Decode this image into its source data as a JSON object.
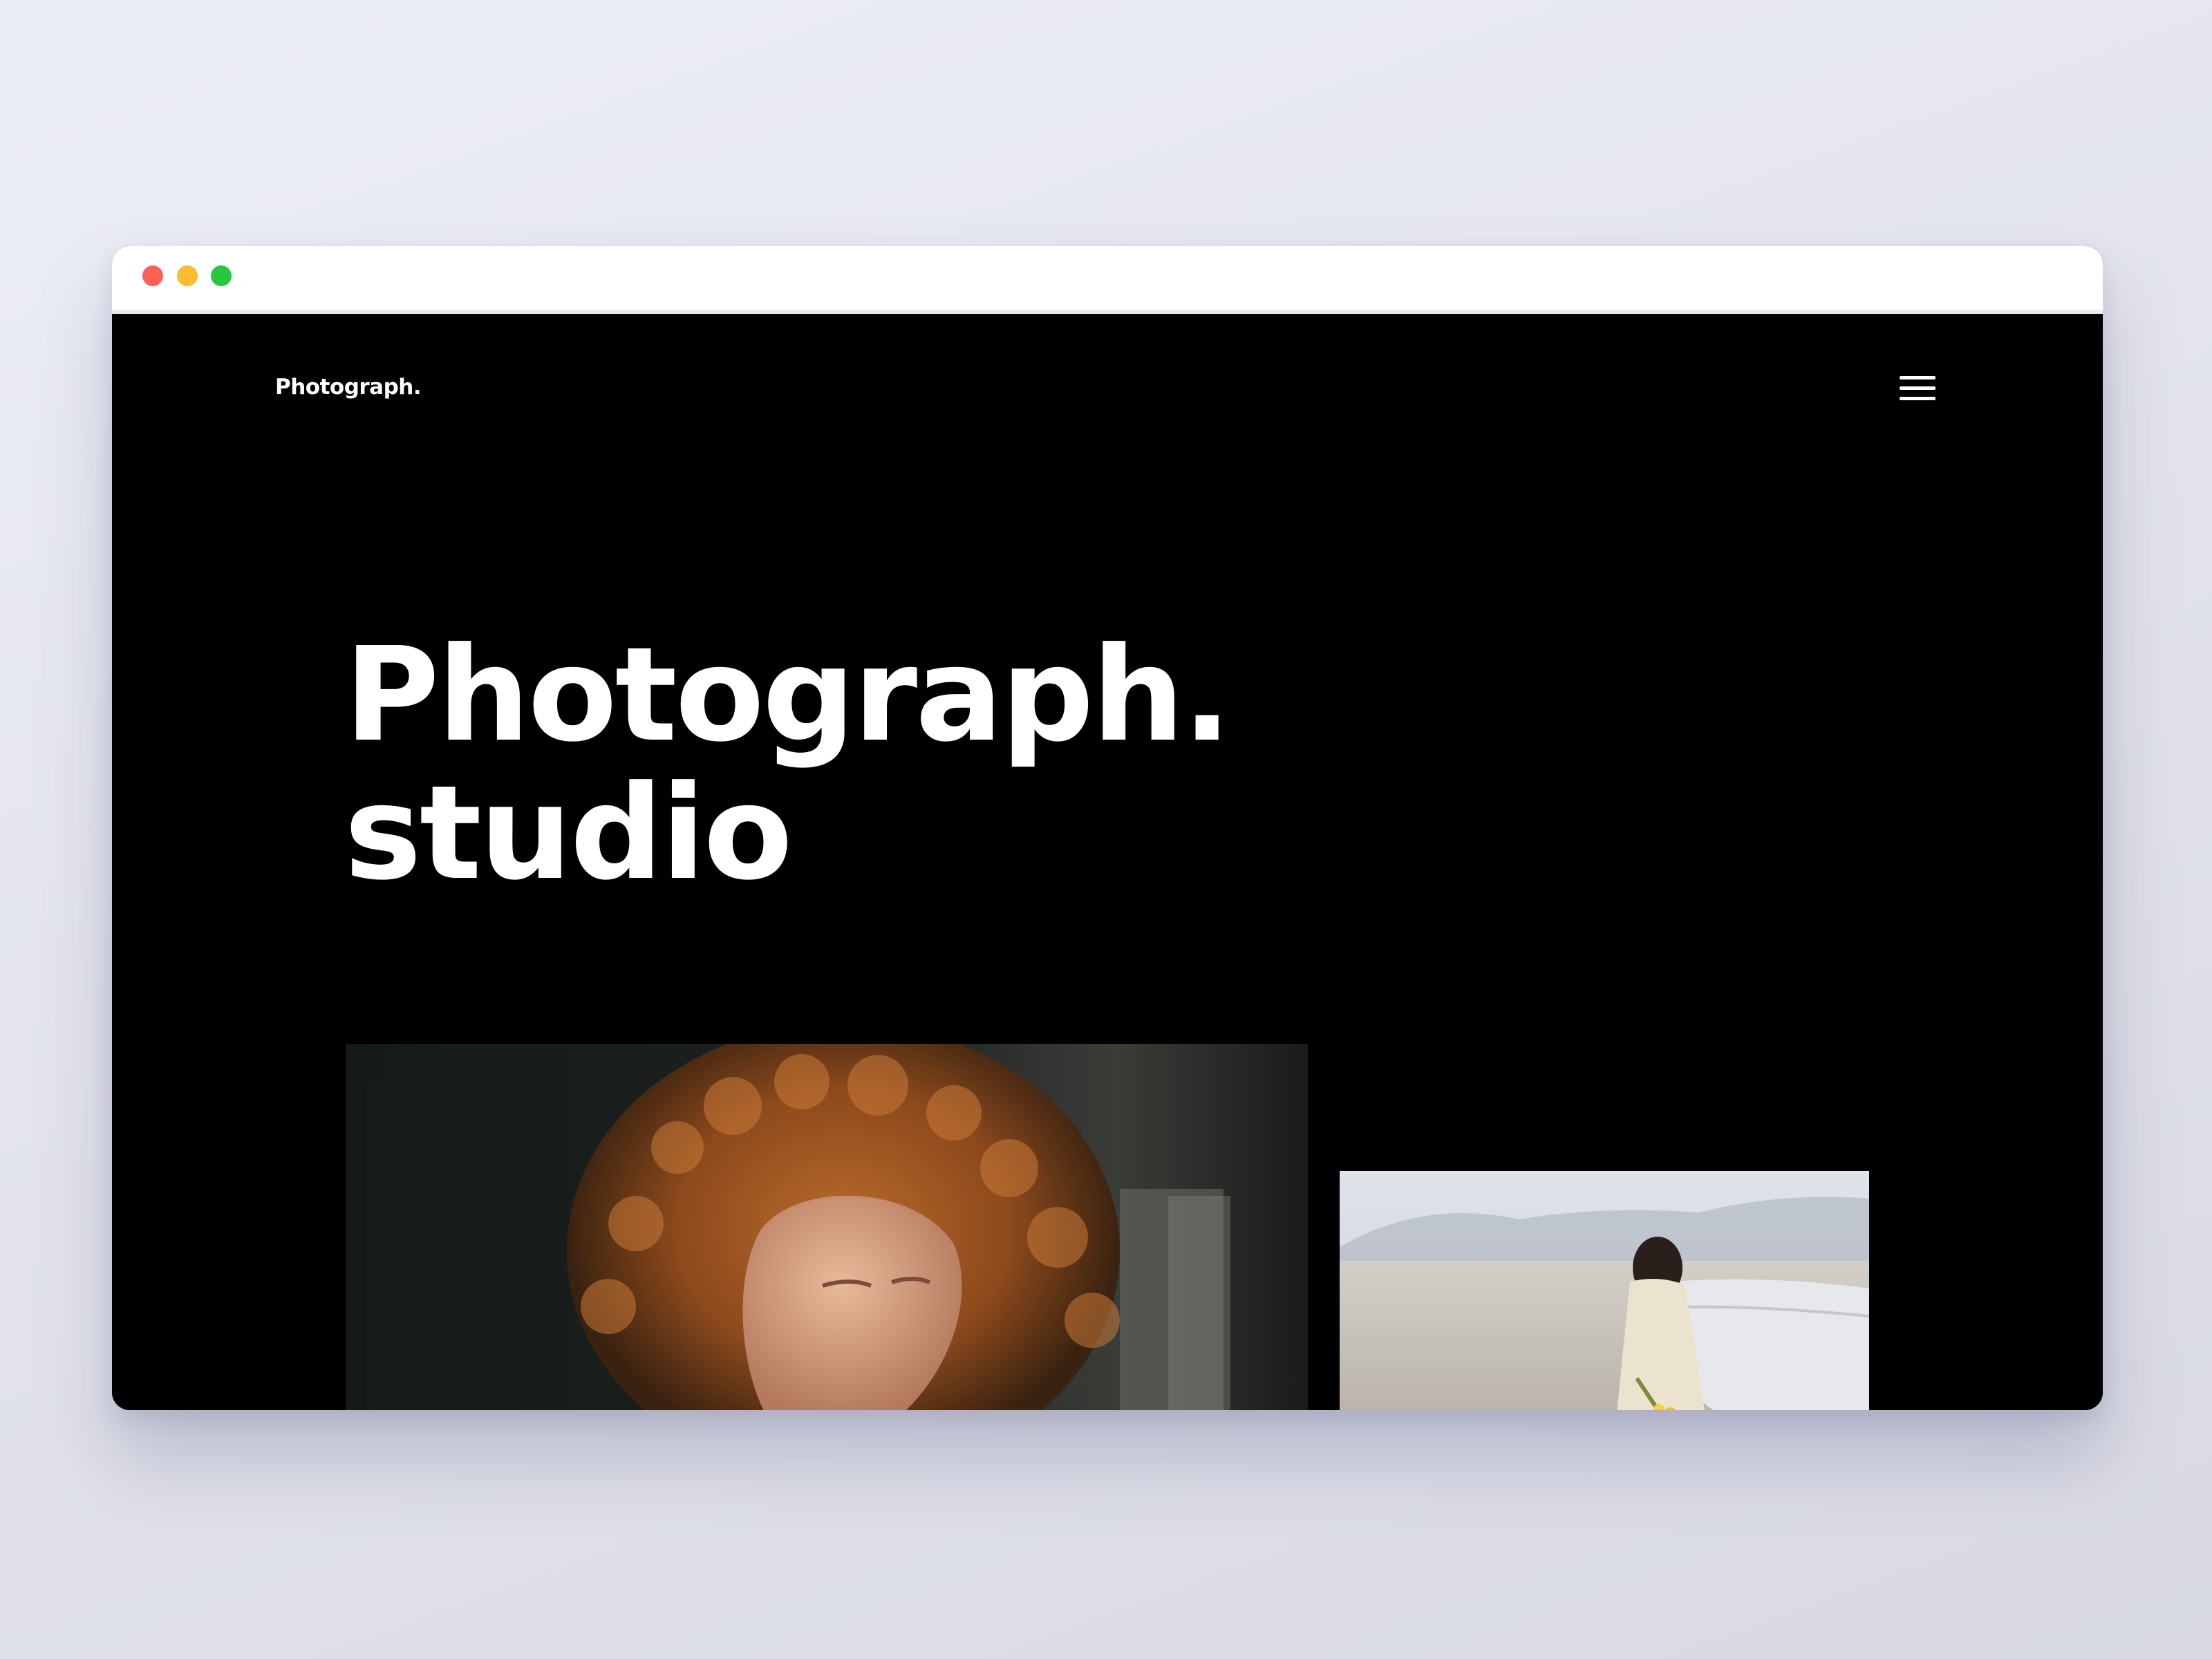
{
  "site": {
    "logo": "Photograph.",
    "menu_icon": "hamburger-menu-icon"
  },
  "hero": {
    "title_line1": "Photograph.",
    "title_line2": "studio"
  },
  "gallery": {
    "items": [
      {
        "image": "portrait of a curly red-haired woman"
      },
      {
        "image": "woman in white dress on a beach holding yellow flowers"
      }
    ]
  },
  "colors": {
    "page_background": "#000000",
    "text": "#ffffff",
    "window_chrome": "#ffffff",
    "traffic_red": "#fe5f57",
    "traffic_yellow": "#febc2e",
    "traffic_green": "#27c840"
  }
}
